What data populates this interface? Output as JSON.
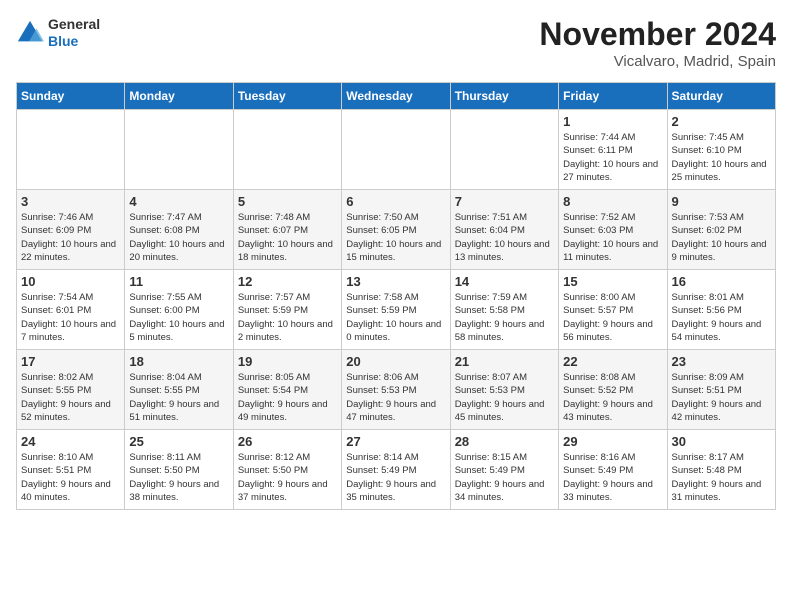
{
  "logo": {
    "general": "General",
    "blue": "Blue"
  },
  "header": {
    "month_title": "November 2024",
    "location": "Vicalvaro, Madrid, Spain"
  },
  "weekdays": [
    "Sunday",
    "Monday",
    "Tuesday",
    "Wednesday",
    "Thursday",
    "Friday",
    "Saturday"
  ],
  "weeks": [
    [
      {
        "day": "",
        "info": ""
      },
      {
        "day": "",
        "info": ""
      },
      {
        "day": "",
        "info": ""
      },
      {
        "day": "",
        "info": ""
      },
      {
        "day": "",
        "info": ""
      },
      {
        "day": "1",
        "info": "Sunrise: 7:44 AM\nSunset: 6:11 PM\nDaylight: 10 hours and 27 minutes."
      },
      {
        "day": "2",
        "info": "Sunrise: 7:45 AM\nSunset: 6:10 PM\nDaylight: 10 hours and 25 minutes."
      }
    ],
    [
      {
        "day": "3",
        "info": "Sunrise: 7:46 AM\nSunset: 6:09 PM\nDaylight: 10 hours and 22 minutes."
      },
      {
        "day": "4",
        "info": "Sunrise: 7:47 AM\nSunset: 6:08 PM\nDaylight: 10 hours and 20 minutes."
      },
      {
        "day": "5",
        "info": "Sunrise: 7:48 AM\nSunset: 6:07 PM\nDaylight: 10 hours and 18 minutes."
      },
      {
        "day": "6",
        "info": "Sunrise: 7:50 AM\nSunset: 6:05 PM\nDaylight: 10 hours and 15 minutes."
      },
      {
        "day": "7",
        "info": "Sunrise: 7:51 AM\nSunset: 6:04 PM\nDaylight: 10 hours and 13 minutes."
      },
      {
        "day": "8",
        "info": "Sunrise: 7:52 AM\nSunset: 6:03 PM\nDaylight: 10 hours and 11 minutes."
      },
      {
        "day": "9",
        "info": "Sunrise: 7:53 AM\nSunset: 6:02 PM\nDaylight: 10 hours and 9 minutes."
      }
    ],
    [
      {
        "day": "10",
        "info": "Sunrise: 7:54 AM\nSunset: 6:01 PM\nDaylight: 10 hours and 7 minutes."
      },
      {
        "day": "11",
        "info": "Sunrise: 7:55 AM\nSunset: 6:00 PM\nDaylight: 10 hours and 5 minutes."
      },
      {
        "day": "12",
        "info": "Sunrise: 7:57 AM\nSunset: 5:59 PM\nDaylight: 10 hours and 2 minutes."
      },
      {
        "day": "13",
        "info": "Sunrise: 7:58 AM\nSunset: 5:59 PM\nDaylight: 10 hours and 0 minutes."
      },
      {
        "day": "14",
        "info": "Sunrise: 7:59 AM\nSunset: 5:58 PM\nDaylight: 9 hours and 58 minutes."
      },
      {
        "day": "15",
        "info": "Sunrise: 8:00 AM\nSunset: 5:57 PM\nDaylight: 9 hours and 56 minutes."
      },
      {
        "day": "16",
        "info": "Sunrise: 8:01 AM\nSunset: 5:56 PM\nDaylight: 9 hours and 54 minutes."
      }
    ],
    [
      {
        "day": "17",
        "info": "Sunrise: 8:02 AM\nSunset: 5:55 PM\nDaylight: 9 hours and 52 minutes."
      },
      {
        "day": "18",
        "info": "Sunrise: 8:04 AM\nSunset: 5:55 PM\nDaylight: 9 hours and 51 minutes."
      },
      {
        "day": "19",
        "info": "Sunrise: 8:05 AM\nSunset: 5:54 PM\nDaylight: 9 hours and 49 minutes."
      },
      {
        "day": "20",
        "info": "Sunrise: 8:06 AM\nSunset: 5:53 PM\nDaylight: 9 hours and 47 minutes."
      },
      {
        "day": "21",
        "info": "Sunrise: 8:07 AM\nSunset: 5:53 PM\nDaylight: 9 hours and 45 minutes."
      },
      {
        "day": "22",
        "info": "Sunrise: 8:08 AM\nSunset: 5:52 PM\nDaylight: 9 hours and 43 minutes."
      },
      {
        "day": "23",
        "info": "Sunrise: 8:09 AM\nSunset: 5:51 PM\nDaylight: 9 hours and 42 minutes."
      }
    ],
    [
      {
        "day": "24",
        "info": "Sunrise: 8:10 AM\nSunset: 5:51 PM\nDaylight: 9 hours and 40 minutes."
      },
      {
        "day": "25",
        "info": "Sunrise: 8:11 AM\nSunset: 5:50 PM\nDaylight: 9 hours and 38 minutes."
      },
      {
        "day": "26",
        "info": "Sunrise: 8:12 AM\nSunset: 5:50 PM\nDaylight: 9 hours and 37 minutes."
      },
      {
        "day": "27",
        "info": "Sunrise: 8:14 AM\nSunset: 5:49 PM\nDaylight: 9 hours and 35 minutes."
      },
      {
        "day": "28",
        "info": "Sunrise: 8:15 AM\nSunset: 5:49 PM\nDaylight: 9 hours and 34 minutes."
      },
      {
        "day": "29",
        "info": "Sunrise: 8:16 AM\nSunset: 5:49 PM\nDaylight: 9 hours and 33 minutes."
      },
      {
        "day": "30",
        "info": "Sunrise: 8:17 AM\nSunset: 5:48 PM\nDaylight: 9 hours and 31 minutes."
      }
    ]
  ]
}
